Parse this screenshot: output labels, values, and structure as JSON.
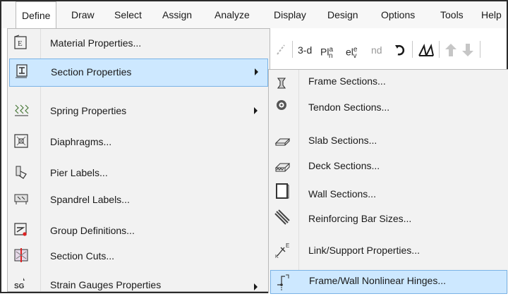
{
  "menubar": {
    "items": [
      {
        "label": "Define"
      },
      {
        "label": "Draw"
      },
      {
        "label": "Select"
      },
      {
        "label": "Assign"
      },
      {
        "label": "Analyze"
      },
      {
        "label": "Display"
      },
      {
        "label": "Design"
      },
      {
        "label": "Options"
      },
      {
        "label": "Tools"
      },
      {
        "label": "Help"
      }
    ]
  },
  "toolbar": {
    "view_3d": "3-d",
    "plan": "Pl",
    "plan_sup": "a",
    "plan_sub": "n",
    "elev": "el",
    "elev_sup": "e",
    "elev_sub": "v",
    "nd": "nd"
  },
  "define_menu": {
    "items": [
      {
        "label": "Material Properties...",
        "icon": "material-icon"
      },
      {
        "label": "Section Properties",
        "icon": "section-properties-icon",
        "has_submenu": true
      },
      {
        "label": "Spring Properties",
        "icon": "spring-icon",
        "has_submenu": true
      },
      {
        "label": "Diaphragms...",
        "icon": "diaphragm-icon"
      },
      {
        "label": "Pier Labels...",
        "icon": "pier-icon"
      },
      {
        "label": "Spandrel Labels...",
        "icon": "spandrel-icon"
      },
      {
        "label": "Group Definitions...",
        "icon": "group-icon"
      },
      {
        "label": "Section Cuts...",
        "icon": "section-cut-icon"
      },
      {
        "label": "Strain Gauges Properties",
        "icon": "strain-gauge-icon",
        "has_submenu": true
      }
    ]
  },
  "section_submenu": {
    "items": [
      {
        "label": "Frame Sections...",
        "icon": "frame-section-icon"
      },
      {
        "label": "Tendon Sections...",
        "icon": "tendon-icon"
      },
      {
        "label": "Slab Sections...",
        "icon": "slab-icon"
      },
      {
        "label": "Deck Sections...",
        "icon": "deck-icon"
      },
      {
        "label": "Wall Sections...",
        "icon": "wall-icon"
      },
      {
        "label": "Reinforcing Bar Sizes...",
        "icon": "rebar-icon"
      },
      {
        "label": "Link/Support Properties...",
        "icon": "link-icon"
      },
      {
        "label": "Frame/Wall Nonlinear Hinges...",
        "icon": "hinge-icon"
      }
    ]
  },
  "strain_gauge_icon_text": "SG"
}
